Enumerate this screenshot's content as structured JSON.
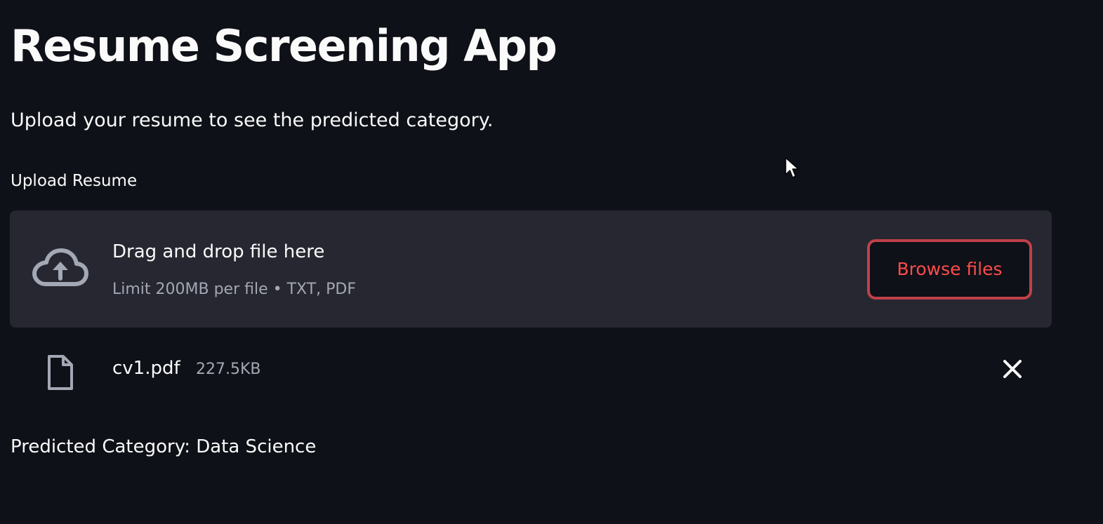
{
  "app": {
    "title": "Resume Screening App",
    "subtitle": "Upload your resume to see the predicted category."
  },
  "uploader": {
    "label": "Upload Resume",
    "drop_title": "Drag and drop file here",
    "drop_limits": "Limit 200MB per file • TXT, PDF",
    "browse_label": "Browse files",
    "upload_icon": "cloud-upload-icon"
  },
  "uploaded_file": {
    "name": "cv1.pdf",
    "size": "227.5KB",
    "file_icon": "file-icon",
    "remove_icon": "close-icon"
  },
  "result": {
    "text": "Predicted Category: Data Science"
  },
  "colors": {
    "background": "#0e1117",
    "dropzone": "#262730",
    "accent": "#ff4b4b",
    "text": "#fafafa",
    "muted_text": "#a3a8b4"
  }
}
